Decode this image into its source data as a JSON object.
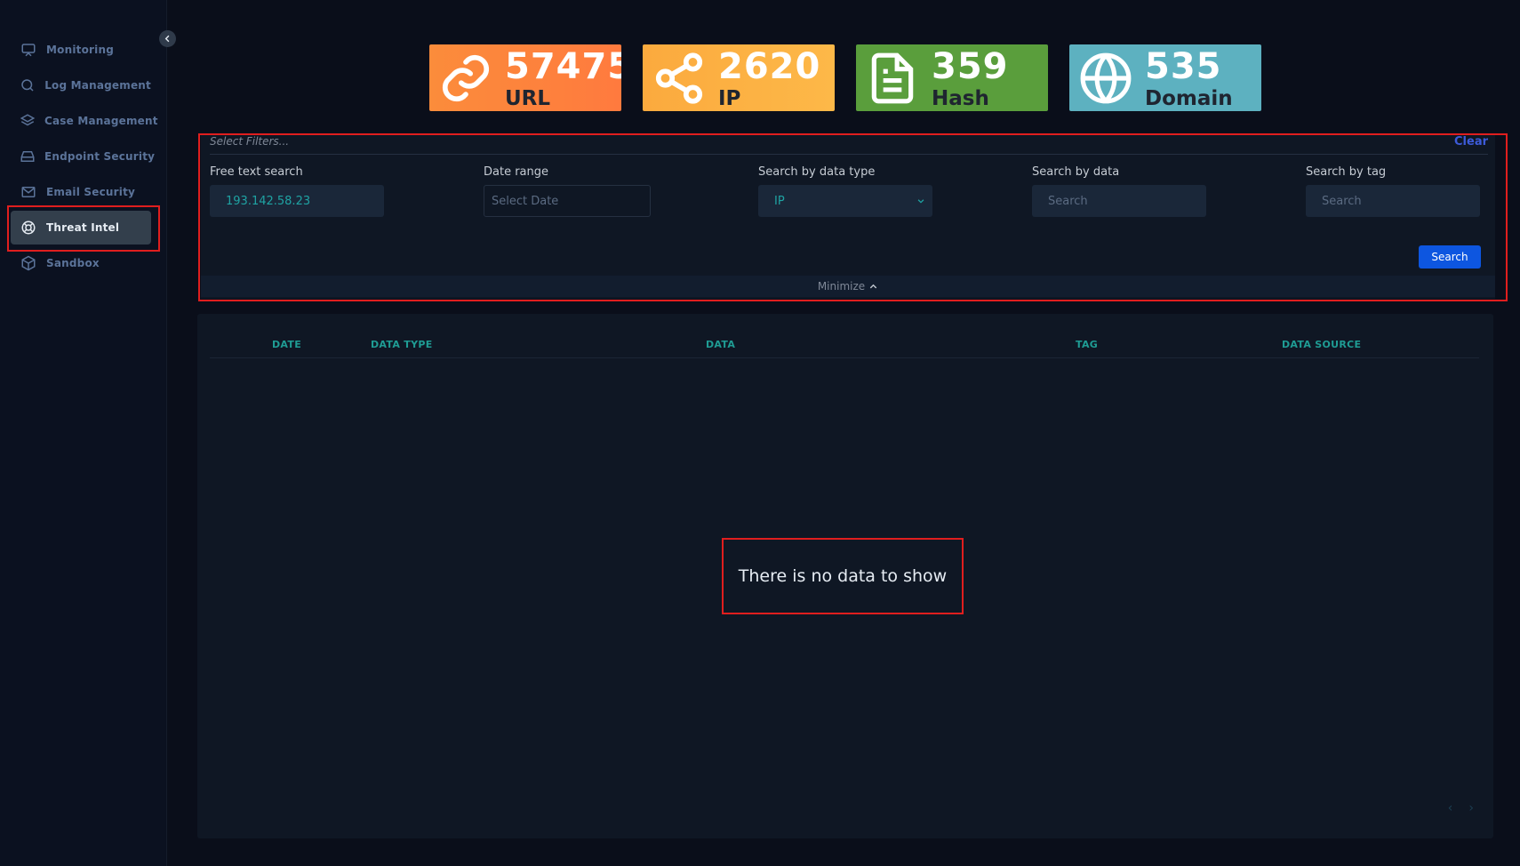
{
  "sidebar": {
    "items": [
      {
        "label": "Monitoring",
        "icon": "monitor-icon"
      },
      {
        "label": "Log Management",
        "icon": "search-icon"
      },
      {
        "label": "Case Management",
        "icon": "layers-icon"
      },
      {
        "label": "Endpoint Security",
        "icon": "hard-drive-icon"
      },
      {
        "label": "Email Security",
        "icon": "mail-icon"
      },
      {
        "label": "Threat Intel",
        "icon": "life-buoy-icon"
      },
      {
        "label": "Sandbox",
        "icon": "box-icon"
      }
    ],
    "active": "Threat Intel"
  },
  "stats": [
    {
      "count": "57475",
      "name": "URL",
      "icon": "link-icon",
      "color": "#fb8c3b"
    },
    {
      "count": "2620",
      "name": "IP",
      "icon": "share-icon",
      "color": "#fbaa3e"
    },
    {
      "count": "359",
      "name": "Hash",
      "icon": "file-icon",
      "color": "#5a9e3c"
    },
    {
      "count": "535",
      "name": "Domain",
      "icon": "globe-icon",
      "color": "#5db1c0"
    }
  ],
  "filters": {
    "title": "Select Filters...",
    "clear": "Clear",
    "free_text": {
      "label": "Free text search",
      "value": "193.142.58.23"
    },
    "date_range": {
      "label": "Date range",
      "placeholder": "Select Date"
    },
    "data_type": {
      "label": "Search by data type",
      "value": "IP"
    },
    "by_data": {
      "label": "Search by data",
      "placeholder": "Search"
    },
    "by_tag": {
      "label": "Search by tag",
      "placeholder": "Search"
    },
    "search_button": "Search",
    "minimize": "Minimize"
  },
  "table": {
    "columns": [
      "DATE",
      "DATA TYPE",
      "DATA",
      "TAG",
      "DATA SOURCE"
    ],
    "empty_message": "There is no data to show"
  },
  "colors": {
    "accent_blue": "#0d56e0",
    "teal": "#1f9c94",
    "highlight_red": "#e01e1e"
  }
}
